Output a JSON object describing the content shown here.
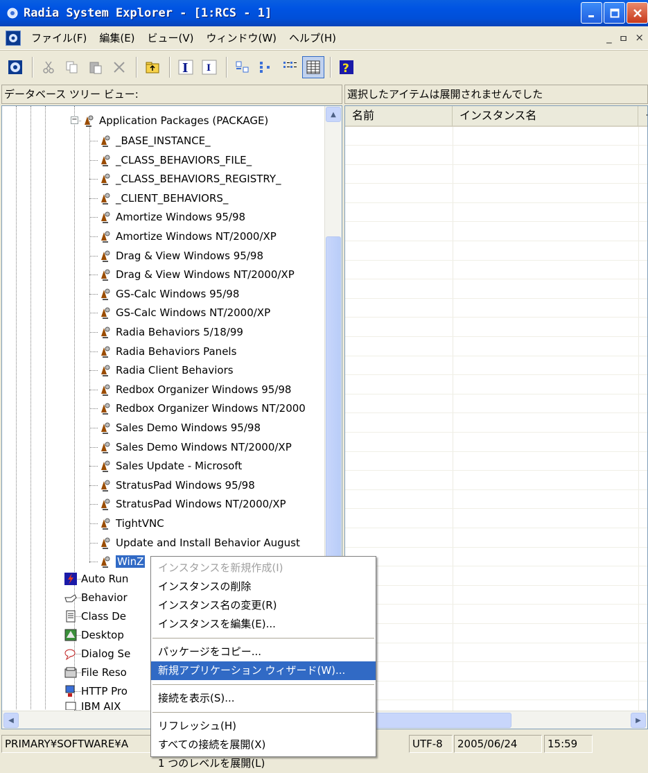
{
  "window": {
    "title": "Radia System Explorer - [1:RCS - 1]"
  },
  "menubar": {
    "items": [
      "ファイル(F)",
      "編集(E)",
      "ビュー(V)",
      "ウィンドウ(W)",
      "ヘルプ(H)"
    ],
    "mdi_controls": [
      "_",
      "ㅁ",
      "×"
    ]
  },
  "toolbar": {
    "buttons": [
      "connect-icon",
      "cut-icon",
      "copy-icon",
      "paste-icon",
      "delete-icon",
      "folder-up-icon",
      "bold-i-icon",
      "italic-i-icon",
      "large-icons-icon",
      "small-icons-icon",
      "list-icon",
      "details-icon",
      "help-icon"
    ]
  },
  "tree_header": "データベース ツリー ビュー:",
  "list_header": "選択したアイテムは展開されませんでした",
  "tree": {
    "root": "Application Packages (PACKAGE)",
    "children": [
      "_BASE_INSTANCE_",
      "_CLASS_BEHAVIORS_FILE_",
      "_CLASS_BEHAVIORS_REGISTRY_",
      "_CLIENT_BEHAVIORS_",
      "Amortize Windows 95/98",
      "Amortize Windows NT/2000/XP",
      "Drag & View Windows 95/98",
      "Drag & View Windows NT/2000/XP",
      "GS-Calc Windows 95/98",
      "GS-Calc Windows NT/2000/XP",
      "Radia Behaviors 5/18/99",
      "Radia Behaviors Panels",
      "Radia Client Behaviors",
      "Redbox Organizer Windows 95/98",
      "Redbox Organizer Windows NT/2000",
      "Sales Demo  Windows 95/98",
      "Sales Demo Windows NT/2000/XP",
      "Sales Update - Microsoft",
      "StratusPad Windows 95/98",
      "StratusPad Windows NT/2000/XP",
      "TightVNC",
      "Update and Install Behavior August",
      "WinZ"
    ],
    "siblings": [
      "Auto Run",
      "Behavior",
      "Class De",
      "Desktop",
      "Dialog Se",
      "File Reso",
      "HTTP Pro",
      "IBM AIX"
    ]
  },
  "list": {
    "columns": [
      "名前",
      "インスタンス名",
      "タ"
    ]
  },
  "context_menu": {
    "items": [
      {
        "label": "インスタンスを新規作成(I)",
        "state": "disabled"
      },
      {
        "label": "インスタンスの削除",
        "state": "normal"
      },
      {
        "label": "インスタンス名の変更(R)",
        "state": "normal"
      },
      {
        "label": "インスタンスを編集(E)...",
        "state": "normal"
      },
      {
        "sep": true
      },
      {
        "label": "パッケージをコピー...",
        "state": "normal"
      },
      {
        "label": "新規アプリケーション ウィザード(W)...",
        "state": "highlight"
      },
      {
        "sep": true
      },
      {
        "label": "接続を表示(S)...",
        "state": "normal"
      },
      {
        "sep": true
      },
      {
        "label": "リフレッシュ(H)",
        "state": "normal"
      },
      {
        "label": "すべての接続を展開(X)",
        "state": "normal"
      },
      {
        "label": "1 つのレベルを展開(L)",
        "state": "normal"
      }
    ]
  },
  "statusbar": {
    "path": "PRIMARY¥SOFTWARE¥A",
    "path_tail": "¥",
    "encoding": "UTF-8",
    "date": "2005/06/24",
    "time": "15:59"
  }
}
